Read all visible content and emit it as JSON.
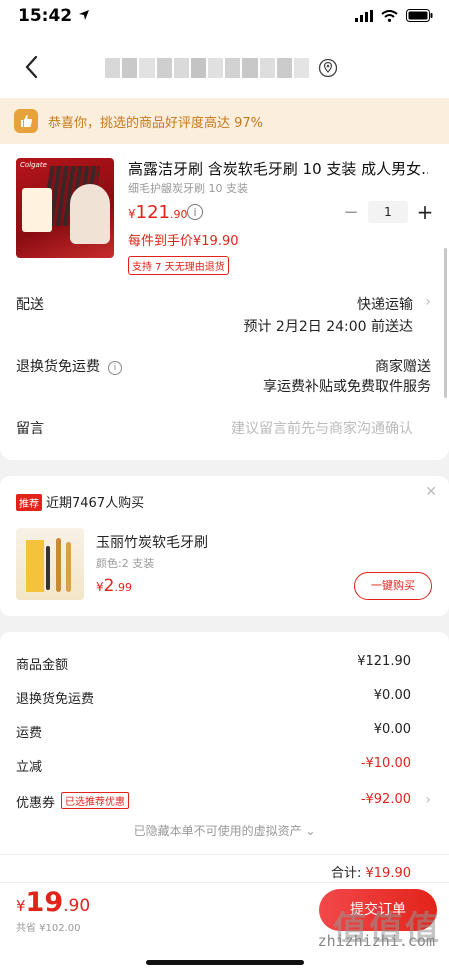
{
  "status": {
    "time": "15:42"
  },
  "notice": {
    "text": "恭喜你，挑选的商品好评度高达 97%"
  },
  "product": {
    "image_brand": "Colgate",
    "title": "高露洁牙刷 含炭软毛牙刷 10 支装 成人男女...",
    "spec": "细毛护龈炭牙刷 10 支装",
    "price_symbol": "¥",
    "price_int": "121",
    "price_dec": ".90",
    "unit_price": "每件到手价¥19.90",
    "return_tag": "支持 7 天无理由退货",
    "quantity": "1",
    "minus": "−",
    "plus": "+"
  },
  "rows": {
    "delivery_label": "配送",
    "delivery_value": "快递运输",
    "delivery_eta": "预计 2月2日 24:00 前送达",
    "return_label": "退换货免运费",
    "return_value": "商家赠送",
    "return_desc": "享运费补贴或免费取件服务",
    "message_label": "留言",
    "message_placeholder": "建议留言前先与商家沟通确认"
  },
  "recommend": {
    "tag": "推荐",
    "text": "近期7467人购买",
    "title": "玉丽竹炭软毛牙刷",
    "spec": "颜色:2 支装",
    "price_symbol": "¥",
    "price_int": "2",
    "price_dec": ".99",
    "button": "一键购买"
  },
  "summary": {
    "items": [
      {
        "label": "商品金额",
        "value": "¥121.90"
      },
      {
        "label": "退换货免运费",
        "value": "¥0.00"
      },
      {
        "label": "运费",
        "value": "¥0.00"
      },
      {
        "label": "立减",
        "value": "-¥10.00"
      },
      {
        "label": "优惠券",
        "value": "-¥92.00",
        "tag": "已选推荐优惠"
      }
    ],
    "hidden_note": "已隐藏本单不可使用的虚拟资产 ⌄",
    "total_label": "合计:",
    "total_value": "¥19.90"
  },
  "bottom": {
    "price_symbol": "¥",
    "price_int": "19",
    "price_dec": ".90",
    "saved": "共省 ¥102.00",
    "submit": "提交订单",
    "watermark": "值值值",
    "watermark_url": "zhizhizhi.com"
  },
  "colors": {
    "accent": "#e2231a",
    "notice_bg": "#fbeedd",
    "notice_text": "#c47a1a"
  }
}
